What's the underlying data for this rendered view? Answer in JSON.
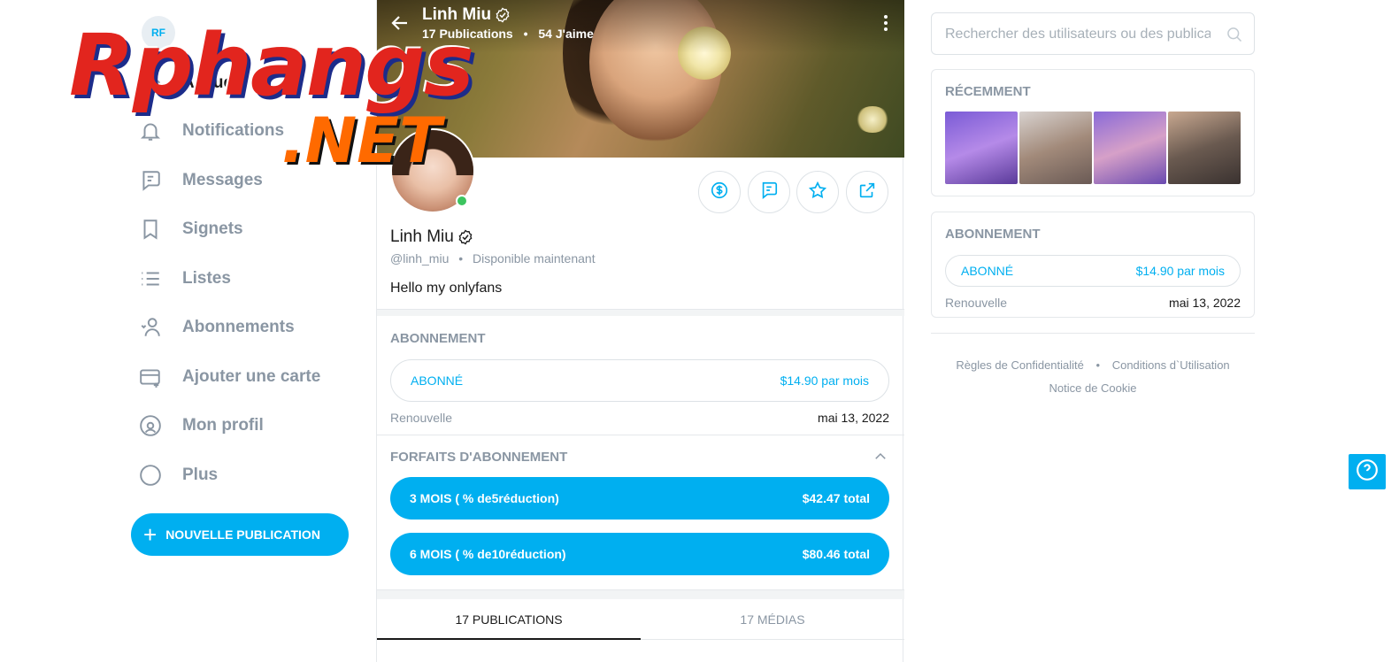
{
  "sidebar": {
    "avatar_initials": "RF",
    "items": [
      {
        "label": "Accueil",
        "icon": "home-icon"
      },
      {
        "label": "Notifications",
        "icon": "bell-icon"
      },
      {
        "label": "Messages",
        "icon": "message-icon"
      },
      {
        "label": "Signets",
        "icon": "bookmark-icon"
      },
      {
        "label": "Listes",
        "icon": "list-icon"
      },
      {
        "label": "Abonnements",
        "icon": "subscriptions-icon"
      },
      {
        "label": "Ajouter une carte",
        "icon": "card-icon"
      },
      {
        "label": "Mon profil",
        "icon": "profile-icon"
      },
      {
        "label": "Plus",
        "icon": "more-icon"
      }
    ],
    "new_post_label": "NOUVELLE PUBLICATION"
  },
  "watermark": {
    "line1": "Rphangs",
    "line2": ".NET"
  },
  "profile": {
    "banner_name": "Linh Miu",
    "posts_count": "17",
    "posts_word": "Publications",
    "likes_count": "54",
    "likes_word": "J'aime",
    "name": "Linh Miu",
    "handle": "@linh_miu",
    "availability": "Disponible maintenant",
    "bio": "Hello my onlyfans"
  },
  "subscription": {
    "title": "ABONNEMENT",
    "status": "ABONNÉ",
    "price": "$14.90 par mois",
    "renew_label": "Renouvelle",
    "renew_date": "mai 13, 2022"
  },
  "bundles": {
    "title": "FORFAITS D'ABONNEMENT",
    "items": [
      {
        "label": "3 MOIS ( % de5réduction)",
        "total": "$42.47 total"
      },
      {
        "label": "6 MOIS ( % de10réduction)",
        "total": "$80.46 total"
      }
    ]
  },
  "tabs": [
    {
      "label": "17 PUBLICATIONS",
      "active": true
    },
    {
      "label": "17 MÉDIAS",
      "active": false
    }
  ],
  "right": {
    "search_placeholder": "Rechercher des utilisateurs ou des publications",
    "recent_title": "RÉCEMMENT",
    "sub_title": "ABONNEMENT",
    "sub_status": "ABONNÉ",
    "sub_price": "$14.90 par mois",
    "renew_label": "Renouvelle",
    "renew_date": "mai 13, 2022",
    "footer": {
      "privacy": "Règles de Confidentialité",
      "terms": "Conditions d`Utilisation",
      "cookie": "Notice de Cookie"
    }
  },
  "colors": {
    "accent": "#00aff0",
    "muted": "#8a96a3",
    "online": "#3cc45f"
  }
}
